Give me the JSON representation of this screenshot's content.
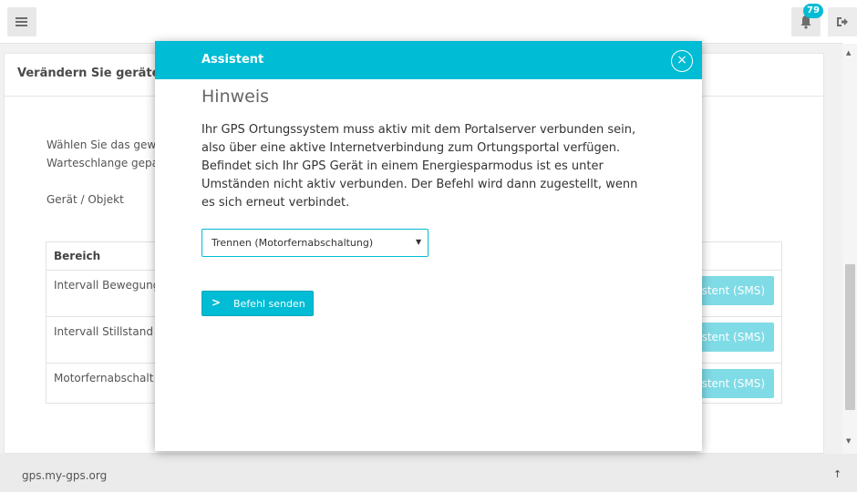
{
  "topbar": {
    "notification_count": "79"
  },
  "card": {
    "header_title": "Verändern Sie gerätesp",
    "text_line1": "Wählen Sie das gew",
    "text_line2": "Warteschlange gepa",
    "label_device": "Gerät / Objekt"
  },
  "table": {
    "header": "Bereich",
    "rows": [
      {
        "label": "Intervall Bewegung",
        "button": "stent (SMS)"
      },
      {
        "label": "Intervall Stillstand",
        "button": "stent (SMS)"
      },
      {
        "label": "Motorfernabschalt",
        "button": "stent (SMS)"
      }
    ]
  },
  "footer": {
    "domain": "gps.my-gps.org",
    "up_icon": "↑"
  },
  "modal": {
    "title": "Assistent",
    "close_icon": "×",
    "heading": "Hinweis",
    "body_lines": [
      "Ihr GPS Ortungssystem muss aktiv mit dem Portalserver verbunden sein,",
      "also über eine aktive Internetverbindung zum Ortungsportal verfügen.",
      "Befindet sich Ihr GPS Gerät in einem Energiesparmodus ist es unter",
      "Umständen nicht aktiv verbunden. Der Befehl wird dann zugestellt, wenn",
      "es sich erneut verbindet."
    ],
    "select_value": "Trennen (Motorfernabschaltung)",
    "send_label": "Befehl senden"
  },
  "colors": {
    "accent": "#00bcd4"
  }
}
